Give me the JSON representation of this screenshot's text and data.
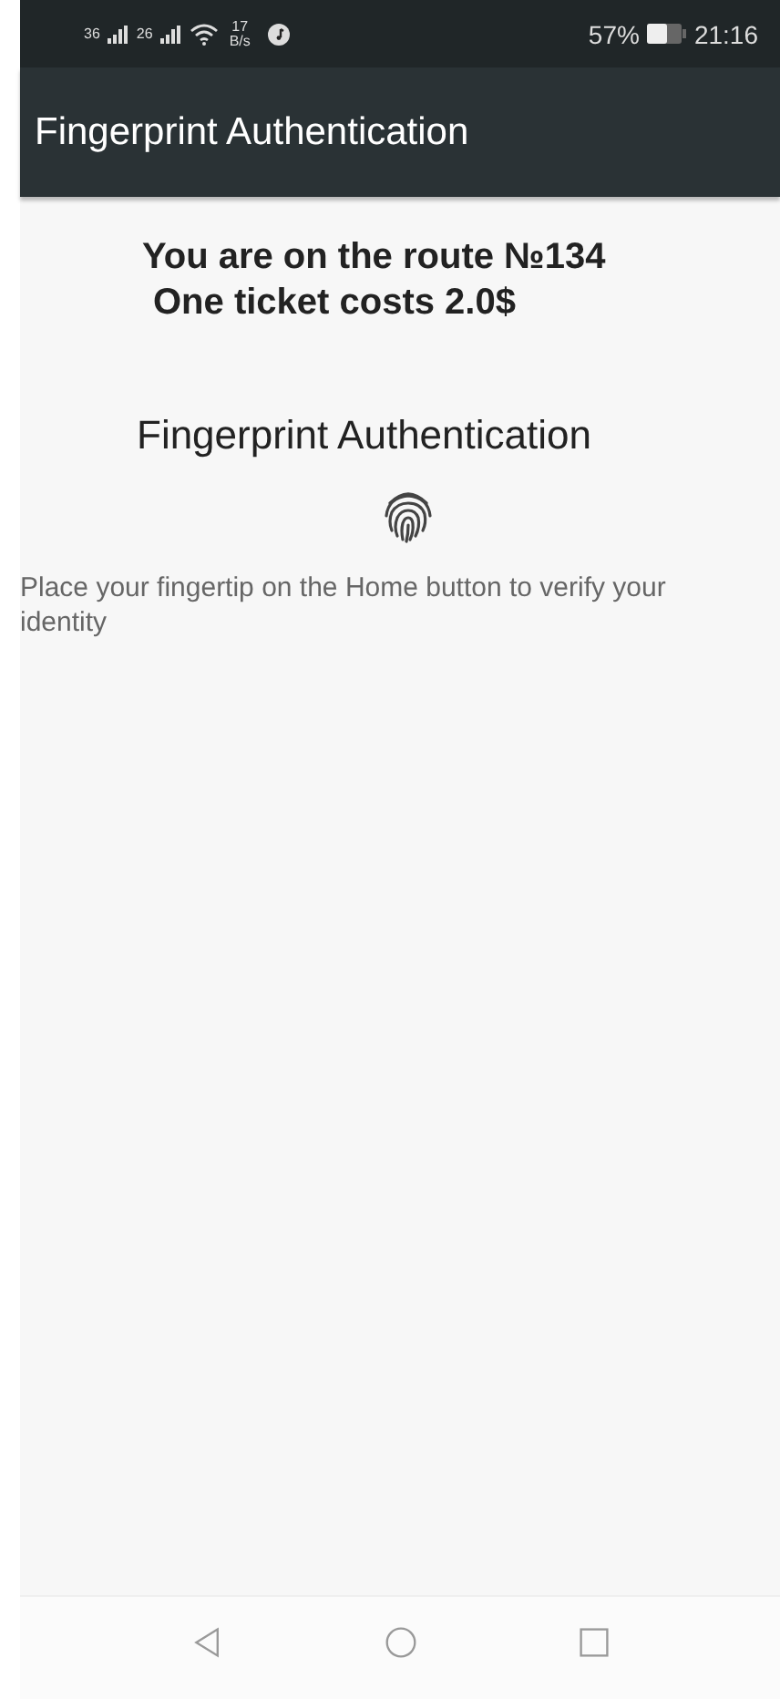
{
  "status_bar": {
    "sim_1": "36",
    "sim_2": "26",
    "speed_value": "17",
    "speed_unit": "B/s",
    "battery": "57%",
    "time": "21:16"
  },
  "app_bar": {
    "title": "Fingerprint Authentication"
  },
  "route_info": [
    "You are on the route №134",
    "One ticket costs 2.0$"
  ],
  "dialog": {
    "title": "Fingerprint Authentication",
    "description": "Place your fingertip on the Home button to verify your identity"
  }
}
